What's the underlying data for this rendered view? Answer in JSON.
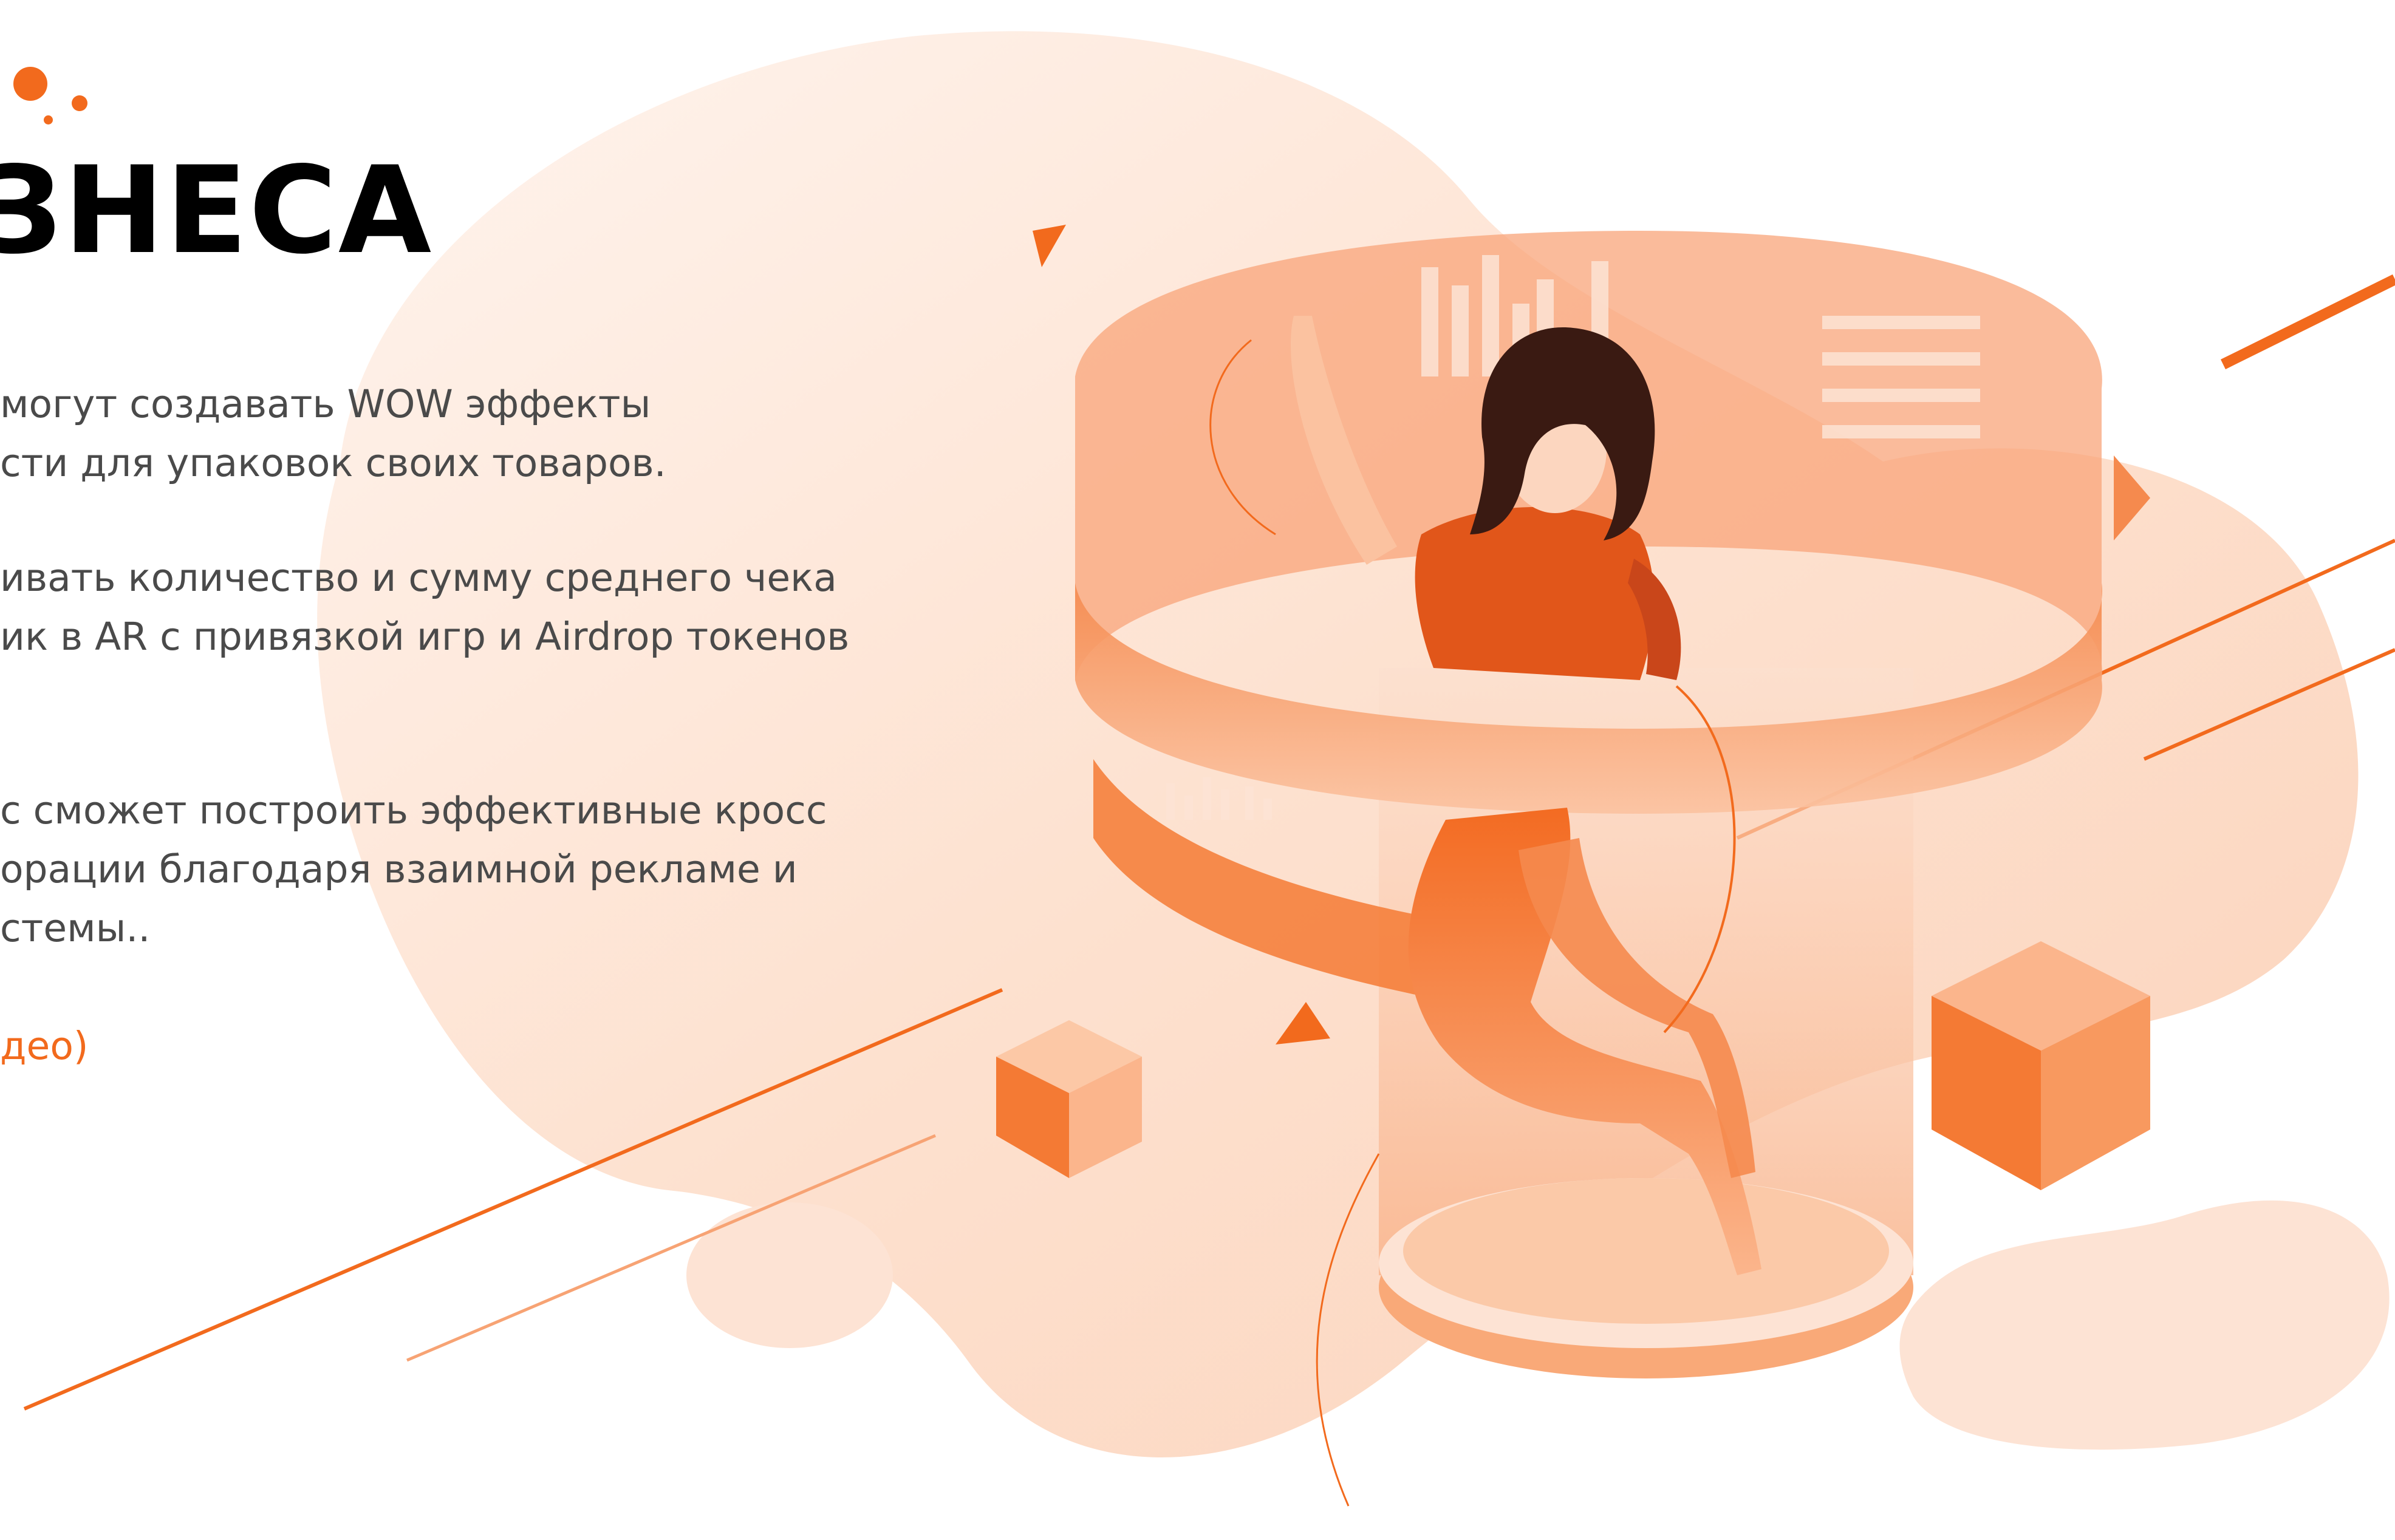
{
  "heading": "ЗНЕСА",
  "paragraphs": [
    {
      "lines": [
        " могут создавать WOW эффекты",
        "сти для упаковок своих товаров."
      ]
    },
    {
      "lines": [
        "ивать количество и сумму среднего чека",
        "ик в AR с привязкой игр и Airdrop токенов"
      ]
    },
    {
      "lines": [
        "с сможет построить эффективные кросс",
        "орации благодаря взаимной рекламе и",
        "стемы.."
      ]
    }
  ],
  "video_link": "део)",
  "colors": {
    "accent": "#f26a1d",
    "blob": "#fde3d4",
    "heading": "#000000",
    "body_text": "#4a4a4a"
  },
  "icons": [
    "decorative-dots-icon",
    "woman-ar-illustration"
  ]
}
